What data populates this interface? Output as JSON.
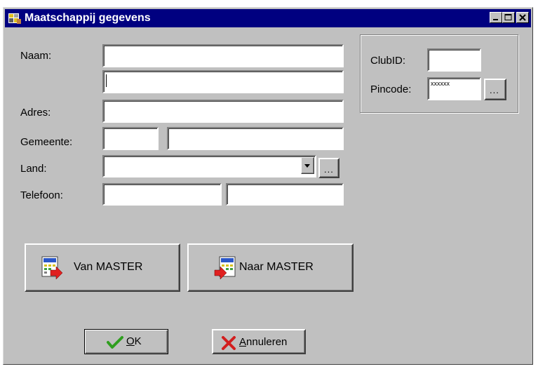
{
  "window": {
    "title": "Maatschappij gegevens"
  },
  "form": {
    "naam_label": "Naam:",
    "adres_label": "Adres:",
    "gemeente_label": "Gemeente:",
    "land_label": "Land:",
    "telefoon_label": "Telefoon:",
    "naam_1": "",
    "naam_2": "",
    "adres": "",
    "postcode": "",
    "gemeente": "",
    "land": "",
    "telefoon_1": "",
    "telefoon_2": "",
    "land_browse": "..."
  },
  "club": {
    "clubid_label": "ClubID:",
    "pincode_label": "Pincode:",
    "clubid": "",
    "pincode": "xxxxxx",
    "pincode_browse": "..."
  },
  "master": {
    "van_label": "Van MASTER",
    "naar_label": "Naar MASTER"
  },
  "actions": {
    "ok_mnemonic": "O",
    "ok_rest": "K",
    "cancel_mnemonic": "A",
    "cancel_rest": "nnuleren"
  },
  "colors": {
    "titlebar": "#000080",
    "face": "#c0c0c0",
    "ok_check": "#2f9e1f",
    "cancel_x": "#d21e1e"
  },
  "icons": [
    "app-icon",
    "minimize-icon",
    "maximize-icon",
    "close-icon",
    "dropdown-arrow-icon",
    "import-icon",
    "export-icon",
    "checkmark-icon",
    "cross-icon"
  ]
}
